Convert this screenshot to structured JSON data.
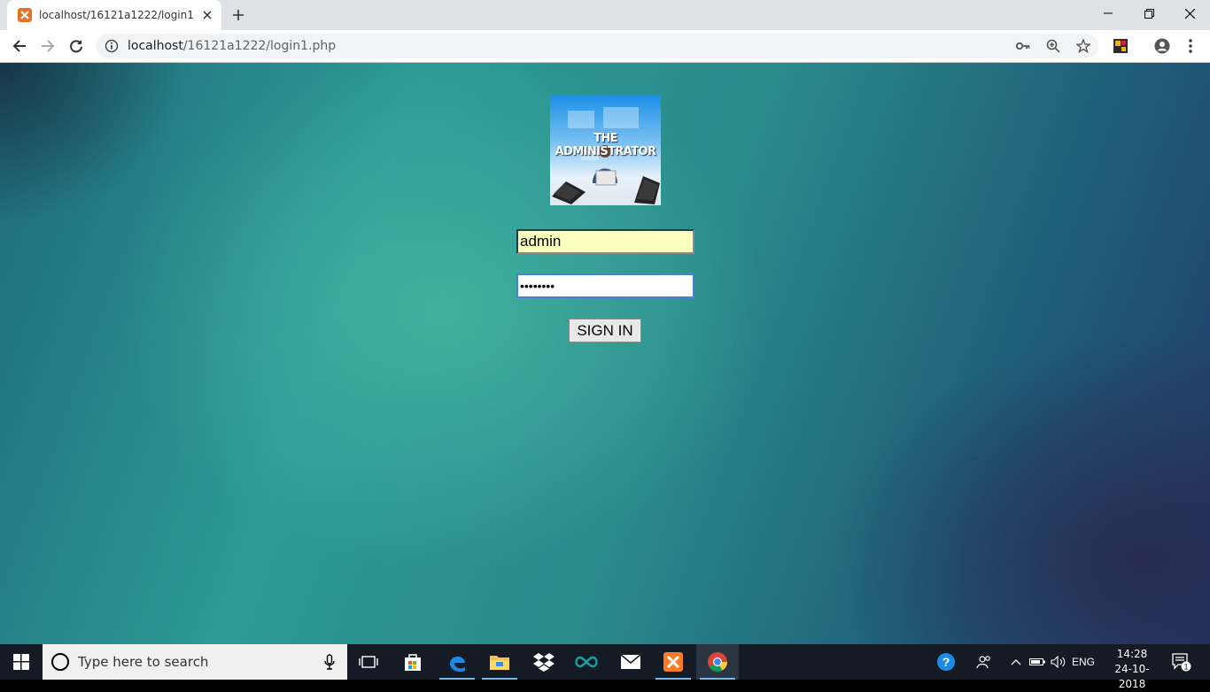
{
  "browser": {
    "tab_title": "localhost/16121a1222/login1.php",
    "url_host": "localhost",
    "url_path": "/16121a1222/login1.php"
  },
  "page": {
    "logo_text": "THE ADMINISTRATOR",
    "username_value": "admin",
    "password_value": "••••••••",
    "signin_label": "SIGN IN"
  },
  "taskbar": {
    "search_placeholder": "Type here to search",
    "language": "ENG",
    "time": "14:28",
    "date": "24-10-2018",
    "notification_count": "1"
  },
  "icons": {
    "favicon": "xampp-icon",
    "taskbar_apps": [
      "task-view-icon",
      "store-icon",
      "edge-icon",
      "file-explorer-icon",
      "dropbox-icon",
      "arduino-icon",
      "mail-icon",
      "xampp-icon",
      "chrome-icon"
    ]
  },
  "colors": {
    "autofill_bg": "#faffbd",
    "focus_border": "#4a7fd6",
    "taskbar_bg": "#141b24"
  }
}
